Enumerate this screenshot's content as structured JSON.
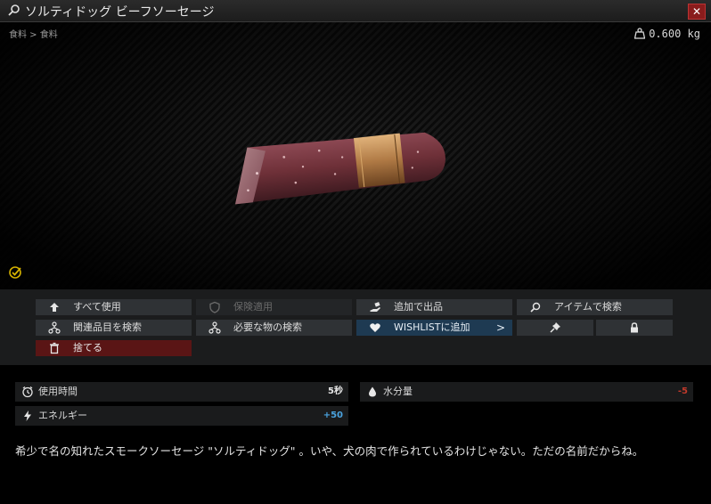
{
  "window": {
    "title": "ソルティドッグ ビーフソーセージ",
    "close_label": "✕"
  },
  "preview": {
    "breadcrumb": "食料 > 食料",
    "weight": "0.600 kg"
  },
  "actions": {
    "use_all": "すべて使用",
    "insure": "保険適用",
    "add_offer": "追加で出品",
    "search_item": "アイテムで検索",
    "search_related": "関連品目を検索",
    "search_required": "必要な物の検索",
    "wishlist": "WISHLISTに追加",
    "wishlist_chevron": ">",
    "discard": "捨てる"
  },
  "stats": {
    "use_time_label": "使用時間",
    "use_time_value": "5秒",
    "hydration_label": "水分量",
    "hydration_value": "-5",
    "energy_label": "エネルギー",
    "energy_value": "+50"
  },
  "description": "希少で名の知れたスモークソーセージ \"ソルティドッグ\" 。いや、犬の肉で作られているわけじゃない。ただの名前だからね。",
  "colors": {
    "positive": "#4aa3df",
    "negative": "#c0392b",
    "examined": "#d4b100",
    "wishlist_bg": "#1e3a52",
    "discard_bg": "#5a1515"
  },
  "icons": {
    "title": "search-icon",
    "weight": "weight-icon",
    "examined": "examined-check-icon",
    "use_all": "upload-arrow-icon",
    "insure": "shield-icon",
    "add_offer": "hand-offer-icon",
    "search_item": "magnifier-icon",
    "search_related": "related-nodes-icon",
    "search_required": "required-nodes-icon",
    "wishlist": "heart-icon",
    "pin": "pin-icon",
    "lock": "lock-icon",
    "discard": "trash-icon",
    "use_time": "clock-icon",
    "hydration": "water-drop-icon",
    "energy": "lightning-icon"
  }
}
